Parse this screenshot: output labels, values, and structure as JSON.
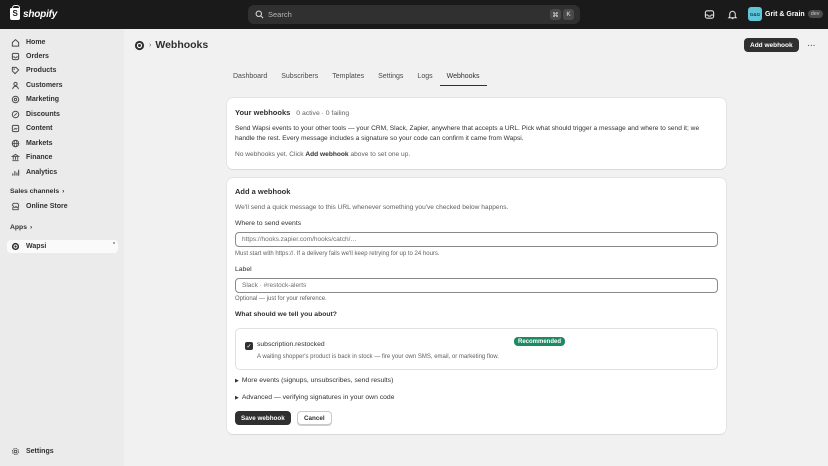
{
  "topbar": {
    "brand": "shopify",
    "search_placeholder": "Search",
    "shortcut_keys": [
      "⌘",
      "K"
    ],
    "store_initials": "G&G",
    "store_name": "Grit & Grain",
    "store_badge": "dev"
  },
  "sidebar": {
    "items": [
      {
        "label": "Home",
        "icon": "home-icon"
      },
      {
        "label": "Orders",
        "icon": "orders-icon"
      },
      {
        "label": "Products",
        "icon": "tag-icon"
      },
      {
        "label": "Customers",
        "icon": "person-icon"
      },
      {
        "label": "Marketing",
        "icon": "target-icon"
      },
      {
        "label": "Discounts",
        "icon": "discount-icon"
      },
      {
        "label": "Content",
        "icon": "content-icon"
      },
      {
        "label": "Markets",
        "icon": "globe-icon"
      },
      {
        "label": "Finance",
        "icon": "bank-icon"
      },
      {
        "label": "Analytics",
        "icon": "chart-icon"
      }
    ],
    "sales_channels_label": "Sales channels",
    "online_store_label": "Online Store",
    "apps_label": "Apps",
    "app_item_label": "Wapsi",
    "settings_label": "Settings"
  },
  "page": {
    "title": "Webhooks",
    "primary_action": "Add webhook",
    "more_actions": "···"
  },
  "tabs": [
    "Dashboard",
    "Subscribers",
    "Templates",
    "Settings",
    "Logs",
    "Webhooks"
  ],
  "active_tab": "Webhooks",
  "summary_card": {
    "title": "Your webhooks",
    "stats": "0 active · 0 failing",
    "description": "Send Wapsi events to your other tools — your CRM, Slack, Zapier, anywhere that accepts a URL. Pick what should trigger a message and where to send it; we handle the rest. Every message includes a signature so your code can confirm it came from Wapsi.",
    "empty_prefix": "No webhooks yet. Click",
    "empty_link": "Add webhook",
    "empty_suffix": "above to set one up."
  },
  "form": {
    "title": "Add a webhook",
    "intro": "We'll send a quick message to this URL whenever something you've checked below happens.",
    "url_label": "Where to send events",
    "url_placeholder": "https://hooks.zapier.com/hooks/catch/…",
    "url_help": "Must start with https://. If a delivery fails we'll keep retrying for up to 24 hours.",
    "label_label": "Label",
    "label_placeholder": "Slack · #restock-alerts",
    "label_help": "Optional — just for your reference.",
    "events_heading": "What should we tell you about?",
    "event": {
      "name": "subscription.restocked",
      "description": "A waiting shopper's product is back in stock — fire your own SMS, email, or marketing flow.",
      "badge": "Recommended",
      "checked": true
    },
    "more_events": "More events (signups, unsubscribes, send results)",
    "advanced": "Advanced — verifying signatures in your own code",
    "save_label": "Save webhook",
    "cancel_label": "Cancel"
  },
  "colors": {
    "topbar": "#1a1a1a",
    "primary_button": "#303030",
    "recommended_badge": "#1c8a62",
    "store_avatar": "#5ec6d8"
  }
}
